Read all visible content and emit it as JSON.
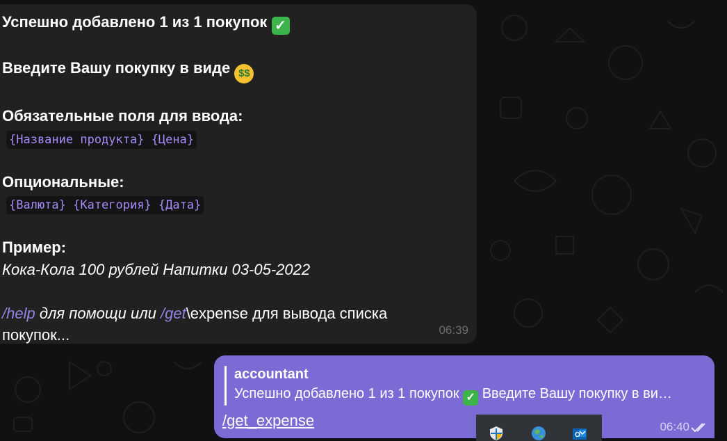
{
  "incoming_message": {
    "line1": "Успешно добавлено 1 из 1 покупок",
    "line1_emoji": "check-mark-emoji",
    "line2": "Введите Вашу покупку в виде",
    "line2_emoji": "money-mouth-emoji",
    "required_title": "Обязательные поля для ввода:",
    "required_fields": "{Название продукта} {Цена}",
    "optional_title": "Опциональные:",
    "optional_fields": "{Валюта} {Категория} {Дата}",
    "example_title": "Пример:",
    "example_text": "Кока-Кола 100 рублей Напитки 03-05-2022",
    "help_cmd": "/help",
    "help_text": " для помощи или ",
    "get_cmd": "/get",
    "get_rest": "\\expense для вывода списка",
    "last_line": "покупок...",
    "time": "06:39"
  },
  "outgoing_message": {
    "reply_author": "accountant",
    "reply_text_1": "Успешно добавлено 1 из 1 покупок",
    "reply_text_2": " Введите Вашу покупку в ви…",
    "text": "/get_expense",
    "time": "06:40",
    "status_icon": "double-check-icon"
  },
  "taskbar": {
    "icons": [
      "shield-icon",
      "globe-icon",
      "outlook-icon"
    ]
  },
  "colors": {
    "incoming_bubble": "#212121",
    "outgoing_bubble": "#7b6bd4",
    "code": "#a78bfa",
    "command": "#9683e0"
  }
}
